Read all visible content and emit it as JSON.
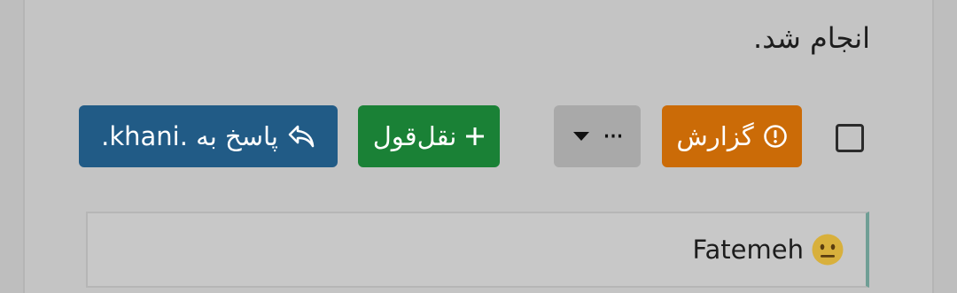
{
  "post": {
    "message_text": "انجام شد."
  },
  "actions": {
    "report_label": "گزارش",
    "more_label": "···",
    "quote_label": "نقل‌قول",
    "reply_label": "پاسخ به .khani."
  },
  "quote": {
    "author": "Fatemeh",
    "emoji_icon": "neutral-face-emoji"
  },
  "colors": {
    "report": "#cb6b07",
    "more": "#a9a9a9",
    "quote": "#1a8136",
    "reply": "#215b86",
    "quote_border": "#6f9e95"
  }
}
